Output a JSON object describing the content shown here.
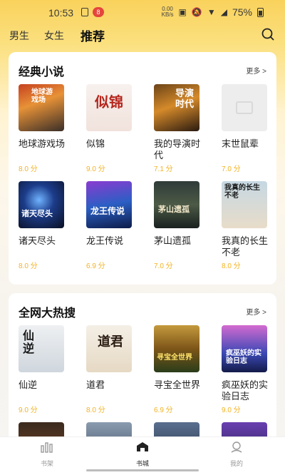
{
  "status_bar": {
    "time": "10:53",
    "notification_count": "8",
    "network_speed_top": "0.00",
    "network_speed_unit": "KB/s",
    "battery_percent": "75%"
  },
  "nav": {
    "tabs": [
      {
        "label": "男生"
      },
      {
        "label": "女生"
      },
      {
        "label": "推荐",
        "active": true
      }
    ]
  },
  "sections": [
    {
      "title": "经典小说",
      "more": "更多 >",
      "books": [
        {
          "title": "地球游戏场",
          "score": "8.0 分",
          "cover_text": "地球游戏场"
        },
        {
          "title": "似锦",
          "score": "9.0 分",
          "cover_text": "似锦"
        },
        {
          "title": "我的导演时代",
          "score": "7.1 分",
          "cover_text": "导演时代"
        },
        {
          "title": "末世鼠辈",
          "score": "7.0 分",
          "cover_text": ""
        },
        {
          "title": "诸天尽头",
          "score": "8.0 分",
          "cover_text": "诸天尽头"
        },
        {
          "title": "龙王传说",
          "score": "6.9 分",
          "cover_text": "龙王传说"
        },
        {
          "title": "茅山遗孤",
          "score": "7.0 分",
          "cover_text": "茅山遗孤"
        },
        {
          "title": "我真的长生不老",
          "score": "8.0 分",
          "cover_text": "我真的长生不老"
        }
      ]
    },
    {
      "title": "全网大热搜",
      "more": "更多 >",
      "books": [
        {
          "title": "仙逆",
          "score": "9.0 分",
          "cover_text": "仙逆"
        },
        {
          "title": "道君",
          "score": "8.0 分",
          "cover_text": "道君"
        },
        {
          "title": "寻宝全世界",
          "score": "6.9 分",
          "cover_text": "寻宝全世界"
        },
        {
          "title": "疯巫妖的实验日志",
          "score": "9.0 分",
          "cover_text": "疯巫妖的实验日志"
        }
      ]
    }
  ],
  "tabbar": [
    {
      "label": "书架",
      "icon": "bookshelf-icon"
    },
    {
      "label": "书城",
      "icon": "bookstore-icon",
      "active": true
    },
    {
      "label": "我的",
      "icon": "profile-icon"
    }
  ],
  "colors": {
    "accent_yellow": "#f9d25c",
    "score_color": "#f2b324",
    "notification_red": "#e4453c"
  }
}
